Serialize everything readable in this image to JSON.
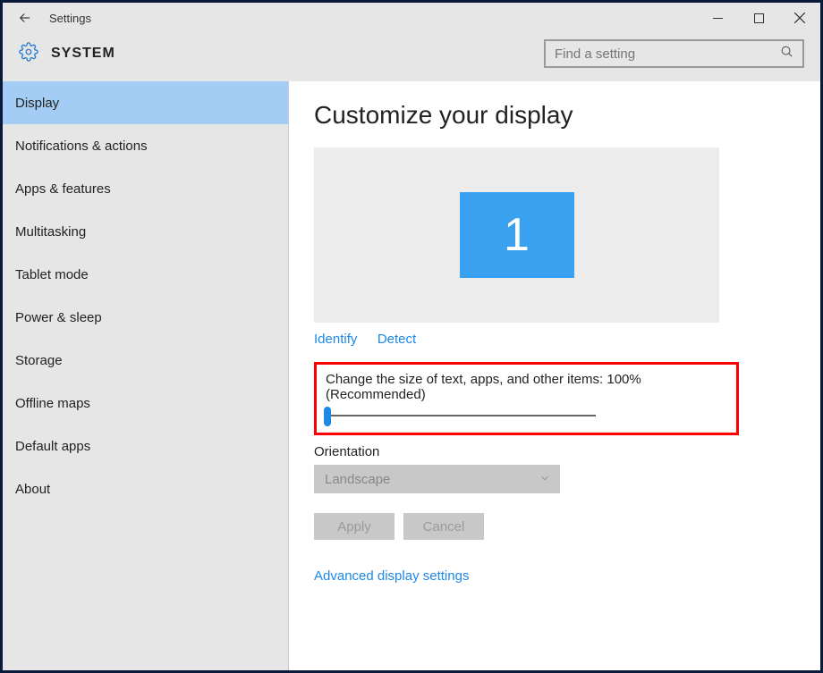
{
  "window": {
    "title": "Settings"
  },
  "header": {
    "section": "SYSTEM",
    "search_placeholder": "Find a setting"
  },
  "sidebar": {
    "items": [
      {
        "label": "Display",
        "selected": true
      },
      {
        "label": "Notifications & actions",
        "selected": false
      },
      {
        "label": "Apps & features",
        "selected": false
      },
      {
        "label": "Multitasking",
        "selected": false
      },
      {
        "label": "Tablet mode",
        "selected": false
      },
      {
        "label": "Power & sleep",
        "selected": false
      },
      {
        "label": "Storage",
        "selected": false
      },
      {
        "label": "Offline maps",
        "selected": false
      },
      {
        "label": "Default apps",
        "selected": false
      },
      {
        "label": "About",
        "selected": false
      }
    ]
  },
  "main": {
    "heading": "Customize your display",
    "monitor_number": "1",
    "identify_link": "Identify",
    "detect_link": "Detect",
    "scale_label": "Change the size of text, apps, and other items: 100% (Recommended)",
    "orientation_label": "Orientation",
    "orientation_value": "Landscape",
    "apply_button": "Apply",
    "cancel_button": "Cancel",
    "advanced_link": "Advanced display settings"
  }
}
